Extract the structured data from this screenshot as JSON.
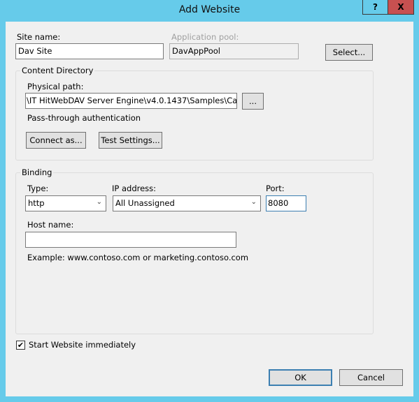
{
  "window": {
    "title": "Add Website",
    "help_label": "?",
    "close_label": "X"
  },
  "site": {
    "site_name_label": "Site name:",
    "site_name_value": "Dav Site",
    "app_pool_label": "Application pool:",
    "app_pool_value": "DavAppPool",
    "select_label": "Select..."
  },
  "content": {
    "legend": "Content Directory",
    "physical_path_label": "Physical path:",
    "physical_path_value": "\\IT HitWebDAV Server Engine\\v4.0.1437\\Samples\\CalDav",
    "browse_label": "...",
    "auth_text": "Pass-through authentication",
    "connect_as_label": "Connect as...",
    "test_settings_label": "Test Settings..."
  },
  "binding": {
    "legend": "Binding",
    "type_label": "Type:",
    "type_value": "http",
    "ip_label": "IP address:",
    "ip_value": "All Unassigned",
    "port_label": "Port:",
    "port_value": "8080",
    "host_label": "Host name:",
    "host_value": "",
    "example": "Example: www.contoso.com or marketing.contoso.com"
  },
  "start": {
    "label": "Start Website immediately",
    "checked": true,
    "check_glyph": "✔"
  },
  "footer": {
    "ok_label": "OK",
    "cancel_label": "Cancel"
  }
}
